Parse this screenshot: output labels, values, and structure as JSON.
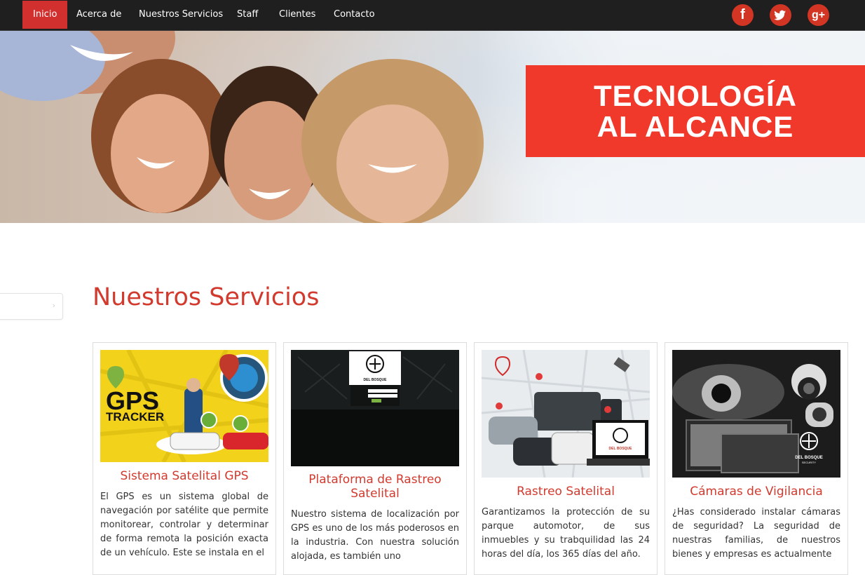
{
  "nav": {
    "items": [
      {
        "label": "Inicio",
        "active": true
      },
      {
        "label": "Acerca de"
      },
      {
        "label": "Nuestros Servicios"
      },
      {
        "label": "Staff"
      },
      {
        "label": "Clientes"
      },
      {
        "label": "Contacto"
      }
    ],
    "social": [
      {
        "icon": "facebook-icon",
        "glyph": "f"
      },
      {
        "icon": "twitter-icon",
        "glyph": "🐦"
      },
      {
        "icon": "google-plus-icon",
        "glyph": "g+"
      }
    ],
    "colors": {
      "bar": "#1e1f1e",
      "active": "#d22f2f",
      "social": "#d23524"
    }
  },
  "hero": {
    "banner_line1": "TECNOLOGÍA",
    "banner_line2": "AL ALCANCE",
    "banner_color": "#f0392b"
  },
  "services": {
    "title": "Nuestros Servicios",
    "accent": "#d23a2e",
    "cards": [
      {
        "title": "Sistema Satelital GPS",
        "image_label_1": "GPS",
        "image_label_2": "TRACKER",
        "text": "El GPS es un sistema global de navegación por satélite que permite monitorear, controlar y determinar de forma remota la posición exacta de un vehículo. Este se instala en el"
      },
      {
        "title": "Plataforma de Rastreo Satelital",
        "image_label": "DEL BOSQUE",
        "text": "Nuestro sistema de localización por GPS es uno de los más poderosos en la industria. Con nuestra solución alojada, es también uno"
      },
      {
        "title": "Rastreo Satelital",
        "image_label": "DEL BOSQUE",
        "text": "Garantizamos la protección de su parque automotor, de sus inmuebles y su trabquilidad las 24 horas del día, los 365 días del año."
      },
      {
        "title": "Cámaras de Vigilancia",
        "image_label_1": "DEL BOSQUE",
        "image_label_2": "SECURITY",
        "text": "¿Has considerado instalar cámaras de seguridad? La seguridad de nuestras familias, de nuestros bienes y empresas es actualmente"
      }
    ]
  }
}
